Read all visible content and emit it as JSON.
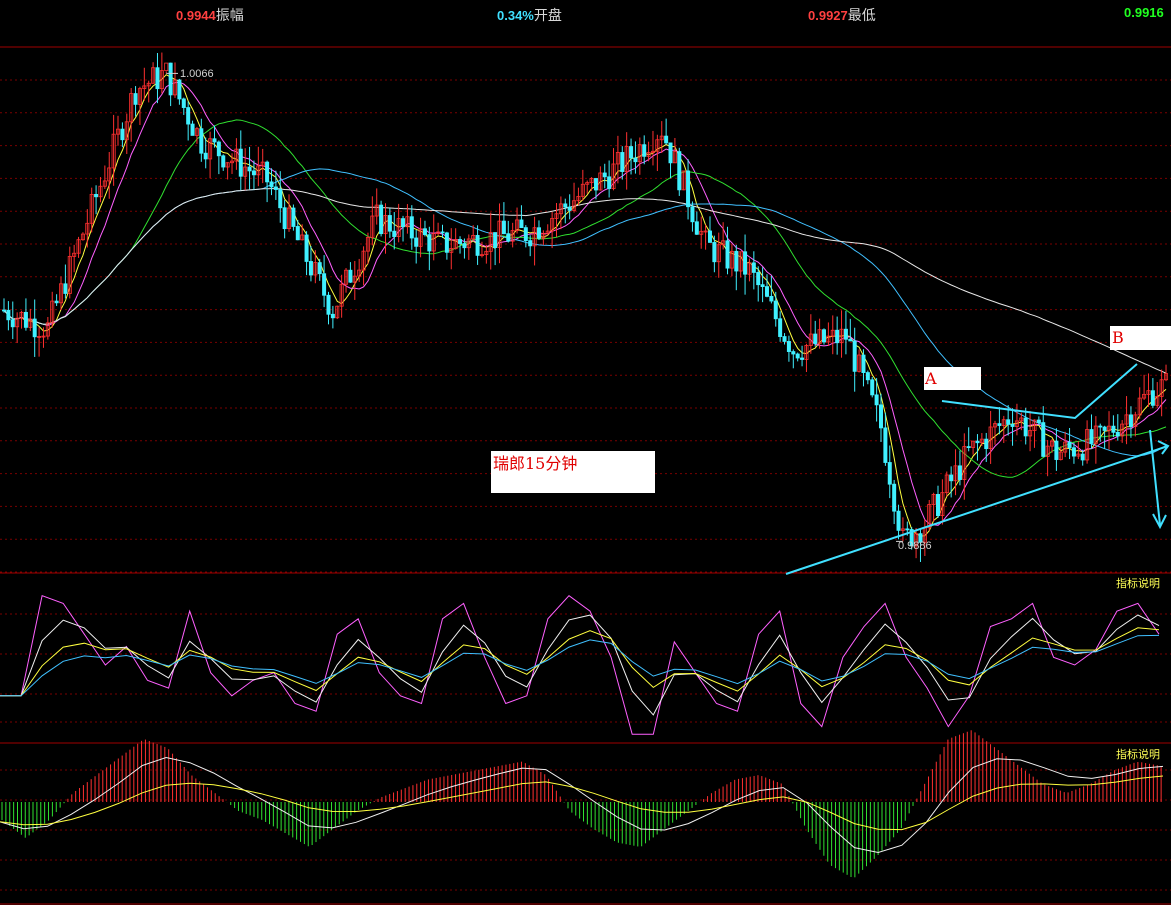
{
  "header": {
    "items": [
      {
        "value": "0.9944",
        "label": "振幅",
        "color": "#ff4040"
      },
      {
        "value": "0.34%",
        "label": "开盘",
        "color": "#40e0ff"
      },
      {
        "value": "0.9927",
        "label": "最低",
        "color": "#ff4040"
      },
      {
        "value": "0.9916",
        "label": "",
        "color": "#20ff20"
      }
    ]
  },
  "colors": {
    "grid": "#7a0000",
    "up": "#ff3030",
    "down": "#40f0ff",
    "ma_white": "#e8e8e8",
    "ma_yellow": "#ffff40",
    "ma_magenta": "#ff60ff",
    "ma_green": "#30e030",
    "ma_cyan": "#40c0ff",
    "annotation": "#40e0ff"
  },
  "annotations": {
    "high_label": "1.0066",
    "low_label": "0.9886",
    "point_a": "A",
    "point_b": "B",
    "title_box": "瑞郎15分钟"
  },
  "indicator_labels": {
    "kdj": "指标说明",
    "macd": "指标说明"
  },
  "chart_data": [
    {
      "type": "candlestick",
      "title": "瑞郎15分钟",
      "ylim": [
        0.9875,
        1.0075
      ],
      "price_key_points": [
        {
          "bar": 0,
          "price": 0.9975
        },
        {
          "bar": 10,
          "price": 0.9968
        },
        {
          "bar": 30,
          "price": 1.006
        },
        {
          "bar": 37,
          "price": 1.0066
        },
        {
          "bar": 45,
          "price": 1.004
        },
        {
          "bar": 60,
          "price": 1.0025
        },
        {
          "bar": 75,
          "price": 0.9975
        },
        {
          "bar": 85,
          "price": 1.001
        },
        {
          "bar": 100,
          "price": 1.0
        },
        {
          "bar": 120,
          "price": 1.0005
        },
        {
          "bar": 140,
          "price": 1.003
        },
        {
          "bar": 150,
          "price": 1.0045
        },
        {
          "bar": 160,
          "price": 1.0
        },
        {
          "bar": 170,
          "price": 0.999
        },
        {
          "bar": 180,
          "price": 0.996
        },
        {
          "bar": 192,
          "price": 0.9965
        },
        {
          "bar": 200,
          "price": 0.993
        },
        {
          "bar": 205,
          "price": 0.9886
        },
        {
          "bar": 210,
          "price": 0.9893
        },
        {
          "bar": 220,
          "price": 0.992
        },
        {
          "bar": 230,
          "price": 0.9935
        },
        {
          "bar": 240,
          "price": 0.992
        },
        {
          "bar": 250,
          "price": 0.9925
        },
        {
          "bar": 262,
          "price": 0.9944
        },
        {
          "bar": 265,
          "price": 0.9946
        }
      ],
      "high": 1.0066,
      "low": 0.9886
    },
    {
      "type": "line",
      "title": "",
      "ylim": [
        0,
        100
      ],
      "series": [
        {
          "color": "#ff60ff",
          "values": [
            30,
            30,
            95,
            90,
            70,
            50,
            62,
            40,
            35,
            85,
            45,
            30,
            40,
            45,
            25,
            20,
            70,
            80,
            45,
            30,
            25,
            80,
            90,
            55,
            25,
            30,
            80,
            95,
            85,
            55,
            5,
            5,
            65,
            45,
            25,
            20,
            70,
            85,
            25,
            10,
            55,
            75,
            90,
            55,
            35,
            10,
            30,
            75,
            80,
            90,
            55,
            50,
            60,
            85,
            90,
            70
          ]
        }
      ]
    },
    {
      "type": "bar",
      "title": "",
      "values": [
        -20,
        -40,
        -20,
        10,
        30,
        50,
        70,
        60,
        30,
        10,
        -10,
        -20,
        -35,
        -50,
        -30,
        -10,
        5,
        15,
        25,
        30,
        35,
        40,
        45,
        30,
        -10,
        -30,
        -45,
        -50,
        -30,
        -10,
        10,
        25,
        30,
        20,
        -30,
        -70,
        -85,
        -60,
        -30,
        20,
        70,
        80,
        60,
        40,
        20,
        10,
        20,
        35,
        45,
        40
      ]
    }
  ]
}
